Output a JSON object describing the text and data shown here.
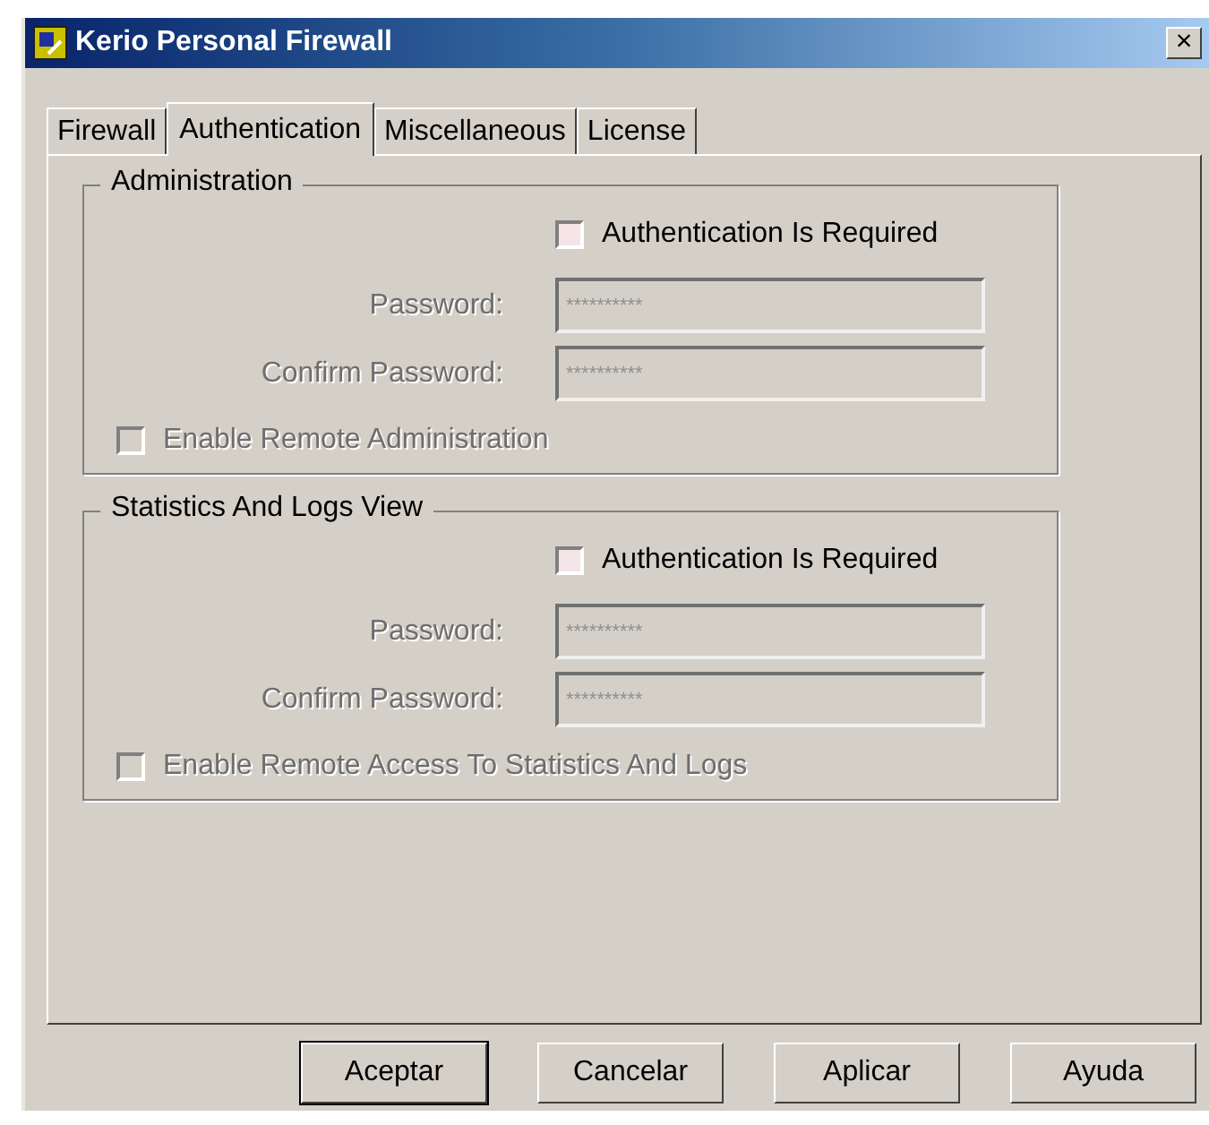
{
  "window": {
    "title": "Kerio Personal Firewall",
    "close": "×"
  },
  "tabs": [
    {
      "label": "Firewall",
      "selected": false
    },
    {
      "label": "Authentication",
      "selected": true
    },
    {
      "label": "Miscellaneous",
      "selected": false
    },
    {
      "label": "License",
      "selected": false
    }
  ],
  "groups": [
    {
      "title": "Administration",
      "auth": {
        "label": "Authentication Is Required",
        "checked": false,
        "disabled": false
      },
      "fields": [
        {
          "label": "Password:",
          "value": "**********",
          "disabled": true
        },
        {
          "label": "Confirm Password:",
          "value": "**********",
          "disabled": true
        }
      ],
      "remote": {
        "label": "Enable Remote Administration",
        "checked": false,
        "disabled": true
      }
    },
    {
      "title": "Statistics And Logs View",
      "auth": {
        "label": "Authentication Is Required",
        "checked": false,
        "disabled": false
      },
      "fields": [
        {
          "label": "Password:",
          "value": "**********",
          "disabled": true
        },
        {
          "label": "Confirm Password:",
          "value": "**********",
          "disabled": true
        }
      ],
      "remote": {
        "label": "Enable Remote Access To Statistics And Logs",
        "checked": false,
        "disabled": true
      }
    }
  ],
  "buttons": [
    {
      "label": "Aceptar",
      "default": true
    },
    {
      "label": "Cancelar",
      "default": false
    },
    {
      "label": "Aplicar",
      "default": false
    },
    {
      "label": "Ayuda",
      "default": false
    }
  ]
}
